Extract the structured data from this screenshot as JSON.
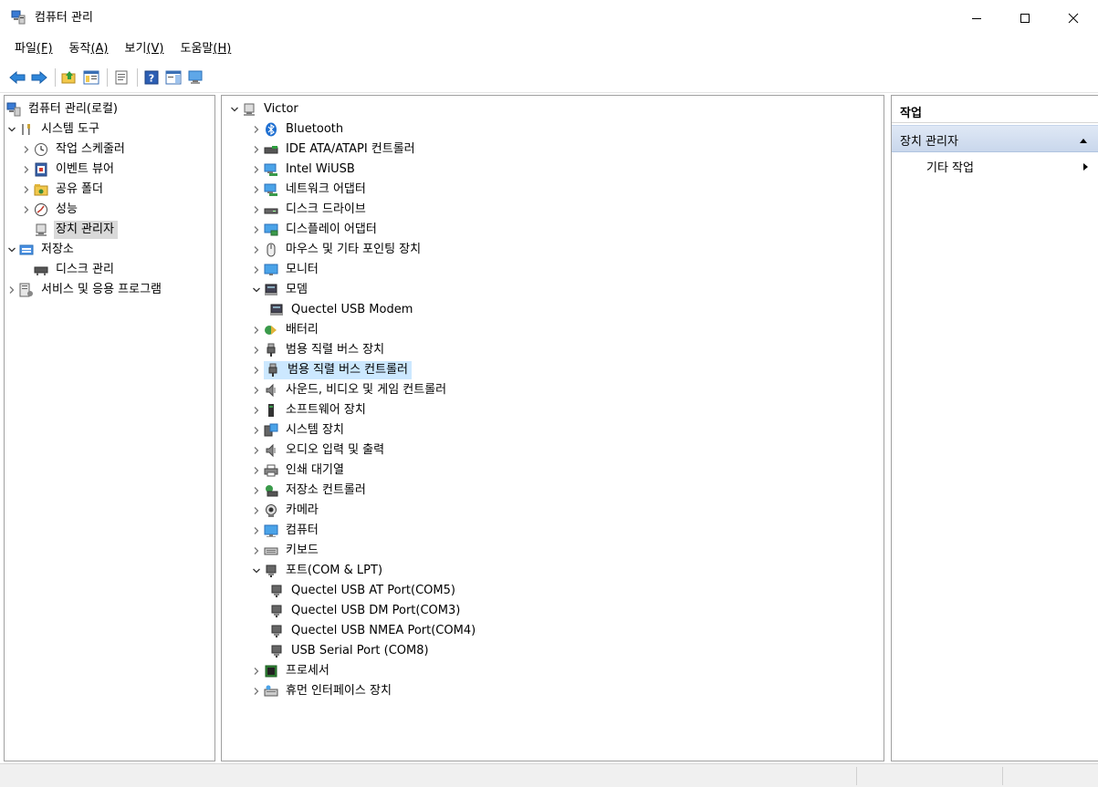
{
  "window": {
    "title": "컴퓨터 관리"
  },
  "menu": [
    {
      "label": "파일",
      "accel": "(F)"
    },
    {
      "label": "동작",
      "accel": "(A)"
    },
    {
      "label": "보기",
      "accel": "(V)"
    },
    {
      "label": "도움말",
      "accel": "(H)"
    }
  ],
  "left_tree": {
    "root": "컴퓨터 관리(로컬)",
    "system_tools": "시스템 도구",
    "task_scheduler": "작업 스케줄러",
    "event_viewer": "이벤트 뷰어",
    "shared_folders": "공유 폴더",
    "performance": "성능",
    "device_manager": "장치 관리자",
    "storage": "저장소",
    "disk_management": "디스크 관리",
    "services": "서비스 및 응용 프로그램"
  },
  "device_tree": {
    "root": "Victor",
    "bluetooth": "Bluetooth",
    "ide": "IDE ATA/ATAPI 컨트롤러",
    "intel_wiusb": "Intel WiUSB",
    "network": "네트워크 어댑터",
    "disk_drives": "디스크 드라이브",
    "display": "디스플레이 어댑터",
    "mouse": "마우스 및 기타 포인팅 장치",
    "monitors": "모니터",
    "modems": "모뎀",
    "modem_child": "Quectel USB Modem",
    "battery": "배터리",
    "usb_devices": "범용 직렬 버스 장치",
    "usb_controllers": "범용 직렬 버스 컨트롤러",
    "sound": "사운드, 비디오 및 게임 컨트롤러",
    "software": "소프트웨어 장치",
    "system": "시스템 장치",
    "audio_io": "오디오 입력 및 출력",
    "print_queue": "인쇄 대기열",
    "storage_ctrl": "저장소 컨트롤러",
    "camera": "카메라",
    "computer": "컴퓨터",
    "keyboard": "키보드",
    "ports": "포트(COM & LPT)",
    "port_at": "Quectel USB AT Port(COM5)",
    "port_dm": "Quectel USB DM Port(COM3)",
    "port_nmea": "Quectel USB NMEA Port(COM4)",
    "port_serial": "USB Serial Port (COM8)",
    "processors": "프로세서",
    "hid": "휴먼 인터페이스 장치"
  },
  "actions": {
    "header": "작업",
    "section": "장치 관리자",
    "more": "기타 작업"
  }
}
